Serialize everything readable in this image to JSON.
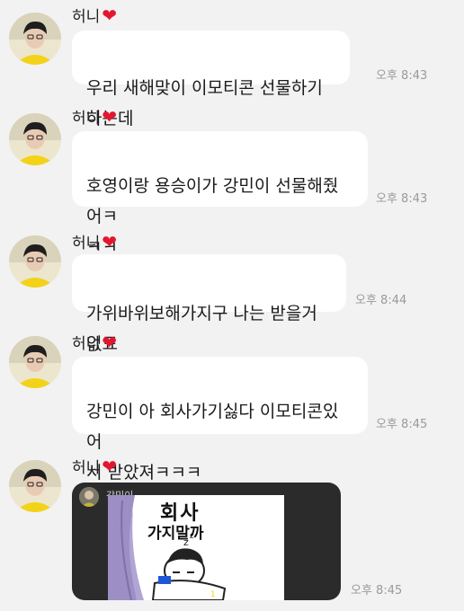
{
  "sender": {
    "name": "허니",
    "heart": "❤"
  },
  "messages": [
    {
      "text": "우리 새해맞이 이모티콘 선물하기하는데",
      "time": "오후 8:43"
    },
    {
      "text": "호영이랑 용승이가 강민이 선물해줬어ㅋ\nㅋㅋ",
      "time": "오후 8:43"
    },
    {
      "text": "가위바위보해가지구 나는 받을거없됴",
      "time": "오후 8:44"
    },
    {
      "text": "강민이 아 회사가기싫다 이모티콘있어\n서 받았져ㅋㅋㅋ",
      "time": "오후 8:45"
    }
  ],
  "emoticon_message": {
    "preview_name": "강민이",
    "sticker_caption_line1": "회사",
    "sticker_caption_line2": "가지말까",
    "page_indicator": "1",
    "time": "오후 8:45"
  },
  "colors": {
    "background": "#f2f2f2",
    "bubble": "#ffffff",
    "heart": "#e2172f",
    "card": "#2b2b2b"
  }
}
